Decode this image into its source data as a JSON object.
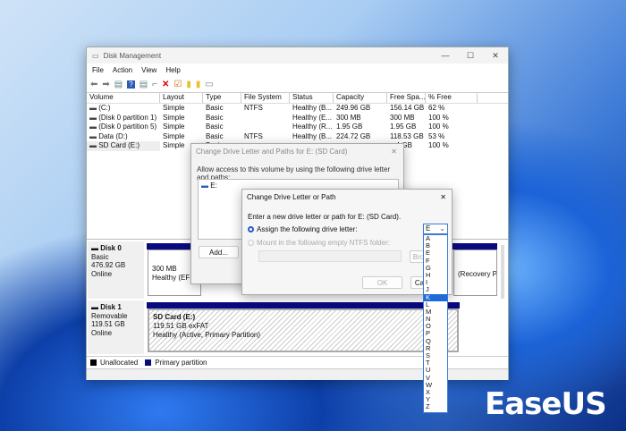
{
  "window": {
    "title": "Disk Management",
    "minimize": "—",
    "maximize": "☐",
    "close": "✕"
  },
  "menu": [
    "File",
    "Action",
    "View",
    "Help"
  ],
  "toolbar_icons": [
    "back-icon",
    "forward-icon",
    "console-tree-icon",
    "help-icon",
    "properties-icon",
    "connect-icon",
    "delete-icon",
    "check-icon",
    "new-folder-icon",
    "search-folder-icon",
    "list-icon"
  ],
  "table": {
    "headers": [
      "Volume",
      "Layout",
      "Type",
      "File System",
      "Status",
      "Capacity",
      "Free Spa...",
      "% Free"
    ],
    "rows": [
      [
        "(C:)",
        "Simple",
        "Basic",
        "NTFS",
        "Healthy (B...",
        "249.96 GB",
        "156.14 GB",
        "62 %"
      ],
      [
        "(Disk 0 partition 1)",
        "Simple",
        "Basic",
        "",
        "Healthy (E...",
        "300 MB",
        "300 MB",
        "100 %"
      ],
      [
        "(Disk 0 partition 5)",
        "Simple",
        "Basic",
        "",
        "Healthy (R...",
        "1.95 GB",
        "1.95 GB",
        "100 %"
      ],
      [
        "Data (D:)",
        "Simple",
        "Basic",
        "NTFS",
        "Healthy (B...",
        "224.72 GB",
        "118.53 GB",
        "53 %"
      ],
      [
        "SD Card (E:)",
        "Simple",
        "Basic",
        "",
        "",
        "",
        "...4 GB",
        "100 %"
      ]
    ]
  },
  "disks": [
    {
      "name": "Disk 0",
      "type": "Basic",
      "size": "476.92 GB",
      "state": "Online",
      "p1_size": "300 MB",
      "p1_status": "Healthy (EFI S",
      "p_last": "(Recovery Pa"
    },
    {
      "name": "Disk 1",
      "type": "Removable",
      "size": "119.51 GB",
      "state": "Online",
      "p_name": "SD Card  (E:)",
      "p_size": "119.51 GB exFAT",
      "p_status": "Healthy (Active, Primary Partition)"
    }
  ],
  "legend": {
    "unallocated": "Unallocated",
    "primary": "Primary partition",
    "unallocated_color": "#000000",
    "primary_color": "#0a0a80"
  },
  "dialog1": {
    "title": "Change Drive Letter and Paths for E: (SD Card)",
    "desc": "Allow access to this volume by using the following drive letter and paths:",
    "item": "E:",
    "add": "Add..."
  },
  "dialog2": {
    "title": "Change Drive Letter or Path",
    "prompt": "Enter a new drive letter or path for E: (SD Card).",
    "opt1": "Assign the following drive letter:",
    "opt2": "Mount in the following empty NTFS folder:",
    "browse": "Bro",
    "ok": "OK",
    "cancel": "Ca",
    "selected_letter": "E"
  },
  "dropdown": {
    "options": [
      "A",
      "B",
      "E",
      "F",
      "G",
      "H",
      "I",
      "J",
      "K",
      "L",
      "M",
      "N",
      "O",
      "P",
      "Q",
      "R",
      "S",
      "T",
      "U",
      "V",
      "W",
      "X",
      "Y",
      "Z"
    ],
    "highlighted": "K"
  },
  "brand": "EaseUS"
}
